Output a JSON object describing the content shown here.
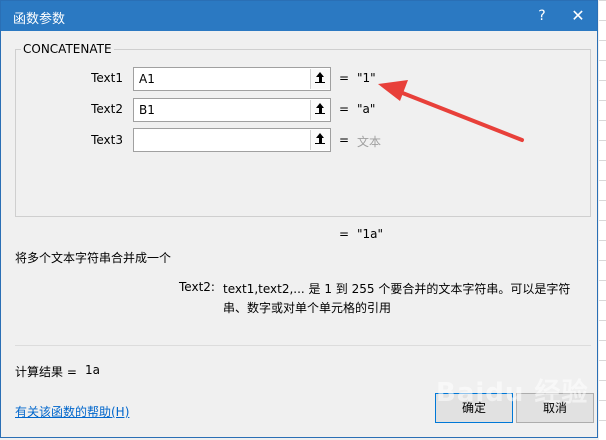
{
  "dialog": {
    "title": "函数参数",
    "help_icon": "?",
    "close_icon": "✕"
  },
  "function_name": "CONCATENATE",
  "arguments": [
    {
      "label": "Text1",
      "value": "A1",
      "result": "\"1\""
    },
    {
      "label": "Text2",
      "value": "B1",
      "result": "\"a\""
    },
    {
      "label": "Text3",
      "value": "",
      "result": "文本"
    }
  ],
  "equals": "=",
  "formula_result": "\"1a\"",
  "description": "将多个文本字符串合并成一个",
  "argument_help": {
    "name": "Text2:",
    "text": "text1,text2,... 是 1 到 255 个要合并的文本字符串。可以是字符串、数字或对单个单元格的引用"
  },
  "calc": {
    "label": "计算结果 =",
    "value": "1a"
  },
  "help_link": "有关该函数的帮助(H)",
  "buttons": {
    "ok": "确定",
    "cancel": "取消"
  },
  "watermark": "Baidu 经验",
  "colors": {
    "titlebar": "#2b79c2",
    "annotation_arrow": "#e8403a",
    "link": "#0066cc"
  }
}
